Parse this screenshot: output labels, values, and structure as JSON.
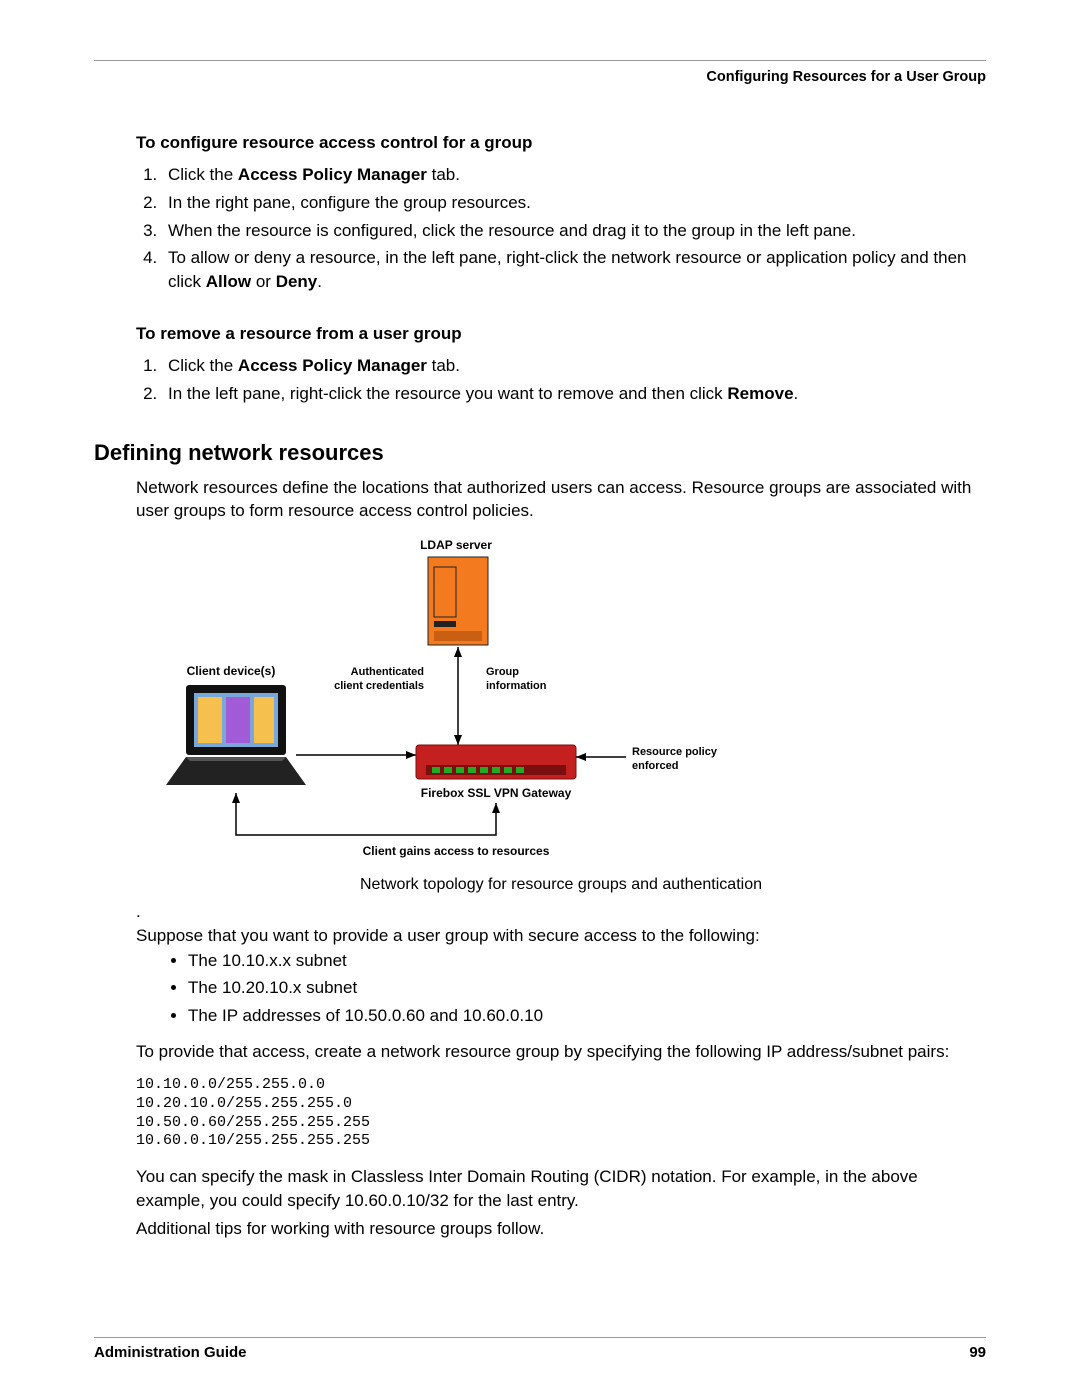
{
  "running_head": "Configuring Resources for a User Group",
  "proc1": {
    "title": "To configure resource access control for a group",
    "steps": [
      {
        "pre": "Click the ",
        "bold": "Access Policy Manager",
        "post": " tab."
      },
      {
        "pre": "In the right pane, configure the group resources.",
        "bold": "",
        "post": ""
      },
      {
        "pre": "When the resource is configured, click the resource and drag it to the group in the left pane.",
        "bold": "",
        "post": ""
      },
      {
        "pre": "To allow or deny a resource, in the left pane, right-click the network resource or application policy and then click ",
        "bold": "Allow",
        "mid": " or ",
        "bold2": "Deny",
        "post": "."
      }
    ]
  },
  "proc2": {
    "title": "To remove a resource from a user group",
    "steps": [
      {
        "pre": "Click the ",
        "bold": "Access Policy Manager",
        "post": " tab."
      },
      {
        "pre": "In the left pane, right-click the resource you want to remove and then click ",
        "bold": "Remove",
        "post": "."
      }
    ]
  },
  "section": {
    "title": "Defining network resources",
    "intro": "Network resources define the locations that authorized users can access. Resource groups are associated with user groups to form resource access control policies."
  },
  "diagram": {
    "ldap": "LDAP server",
    "client": "Client device(s)",
    "auth_line1": "Authenticated",
    "auth_line2": "client credentials",
    "group_line1": "Group",
    "group_line2": "information",
    "policy_line1": "Resource policy",
    "policy_line2": "enforced",
    "gateway": "Firebox SSL VPN Gateway",
    "bottom": "Client gains access to resources"
  },
  "caption": "Network topology for resource groups and authentication",
  "dot": ".",
  "suppose": "Suppose that you want to provide a user group with secure access to the following:",
  "bullets": [
    "The 10.10.x.x subnet",
    "The 10.20.10.x subnet",
    "The IP addresses of 10.50.0.60 and 10.60.0.10"
  ],
  "toprovide": "To provide that access, create a network resource group by specifying the following IP address/subnet pairs:",
  "code": "10.10.0.0/255.255.0.0\n10.20.10.0/255.255.255.0\n10.50.0.60/255.255.255.255\n10.60.0.10/255.255.255.255",
  "cidr": "You can specify the mask in Classless Inter Domain Routing (CIDR) notation. For example, in the above example, you could specify 10.60.0.10/32 for the last entry.",
  "tips": "Additional tips for working with resource groups follow.",
  "footer_left": "Administration Guide",
  "footer_right": "99"
}
